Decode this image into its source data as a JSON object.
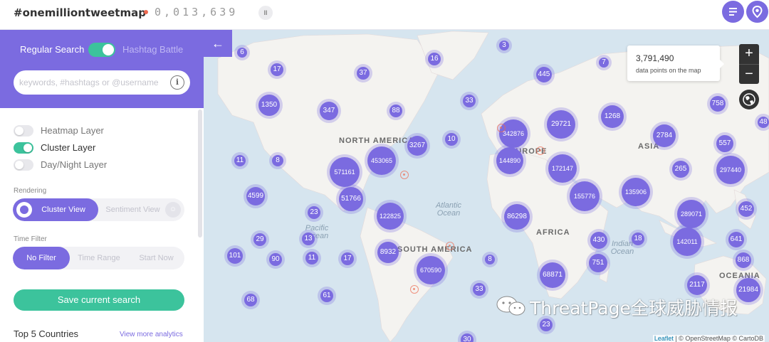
{
  "header": {
    "brand": "#onemilliontweetmap",
    "counter": "0,013,639",
    "pause_icon": "II",
    "menu_icon": "menu-icon",
    "location_icon": "location-pin-icon"
  },
  "sidebar": {
    "mode_regular": "Regular Search",
    "mode_hashtag": "Hashtag Battle",
    "search_placeholder": "keywords, #hashtags or @username",
    "info_icon": "i",
    "layers": [
      {
        "label": "Heatmap Layer",
        "on": false
      },
      {
        "label": "Cluster Layer",
        "on": true
      },
      {
        "label": "Day/Night Layer",
        "on": false
      }
    ],
    "rendering_label": "Rendering",
    "rendering_options": [
      "Cluster View",
      "Sentiment View"
    ],
    "time_filter_label": "Time Filter",
    "time_options": [
      "No Filter",
      "Time Range",
      "Start Now"
    ],
    "save_label": "Save current search",
    "top5_label": "Top 5 Countries",
    "view_more": "View more analytics"
  },
  "map": {
    "back_icon": "←",
    "tooltip_count": "3,791,490",
    "tooltip_text": "data points on the map",
    "zoom_in": "+",
    "zoom_out": "−",
    "globe_icon": "globe-icon",
    "attribution_leaflet": "Leaflet",
    "attribution_rest": " | © OpenStreetMap © CartoDB",
    "labels": {
      "north_america": "NORTH AMERICA",
      "south_america": "SOUTH AMERICA",
      "europe": "EUROPE",
      "africa": "AFRICA",
      "asia": "ASIA",
      "oceania": "OCEANIA",
      "atlantic": "Atlantic Ocean",
      "pacific": "Pacific Ocean",
      "indian": "Indian Ocean"
    },
    "clusters": [
      "6",
      "17",
      "37",
      "16",
      "3",
      "445",
      "7",
      "1350",
      "347",
      "88",
      "33",
      "1268",
      "758",
      "48",
      "29721",
      "342876",
      "2784",
      "3267",
      "10",
      "557",
      "11",
      "8",
      "453065",
      "571161",
      "144890",
      "172147",
      "265",
      "297440",
      "4599",
      "51766",
      "155776",
      "135906",
      "23",
      "122825",
      "86298",
      "289071",
      "452",
      "29",
      "13",
      "18",
      "430",
      "142011",
      "641",
      "101",
      "90",
      "11",
      "17",
      "8932",
      "8",
      "670590",
      "751",
      "868",
      "68871",
      "2117",
      "21984",
      "68",
      "61",
      "33",
      "23",
      "30"
    ],
    "watermark_text": "ThreatPage全球威胁情报"
  }
}
